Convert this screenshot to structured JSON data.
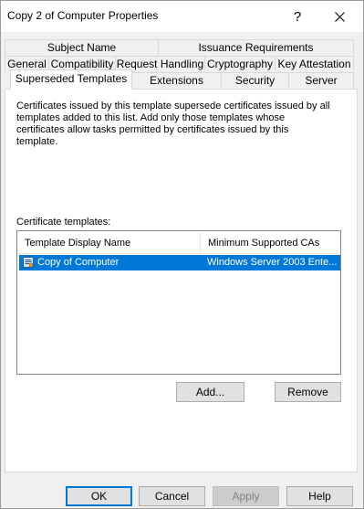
{
  "window": {
    "title": "Copy 2 of Computer Properties",
    "help_glyph": "?",
    "close_icon": "close-icon"
  },
  "tabs": {
    "row1": [
      "Subject Name",
      "Issuance Requirements"
    ],
    "row2": [
      "General",
      "Compatibility",
      "Request Handling",
      "Cryptography",
      "Key Attestation"
    ],
    "row3": [
      "Superseded Templates",
      "Extensions",
      "Security",
      "Server"
    ],
    "active": "Superseded Templates"
  },
  "panel": {
    "description": "Certificates issued by this template supersede certificates issued by all templates added to this list. Add only those templates whose certificates allow tasks permitted by certificates issued by this template.",
    "list_label": "Certificate templates:",
    "columns": [
      "Template Display Name",
      "Minimum Supported CAs"
    ],
    "rows": [
      {
        "name": "Copy of Computer",
        "min_ca": "Windows Server 2003 Ente...",
        "selected": true,
        "icon": "certificate-template-icon"
      }
    ],
    "add_label": "Add...",
    "remove_label": "Remove"
  },
  "footer": {
    "ok": "OK",
    "cancel": "Cancel",
    "apply": "Apply",
    "help": "Help"
  },
  "colors": {
    "selection": "#0078d7",
    "default_button_border": "#0078d7"
  }
}
